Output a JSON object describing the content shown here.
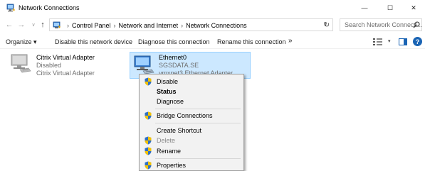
{
  "window": {
    "title": "Network Connections",
    "minimize_glyph": "—",
    "maximize_glyph": "☐",
    "close_glyph": "✕"
  },
  "nav": {
    "back_glyph": "←",
    "forward_glyph": "→",
    "recent_glyph": "∨",
    "up_glyph": "↑"
  },
  "address": {
    "separator": "›",
    "crumbs": [
      "Control Panel",
      "Network and Internet",
      "Network Connections"
    ],
    "dropdown_glyph": "∨",
    "refresh_glyph": "↻"
  },
  "search": {
    "placeholder": "Search Network Connecti..."
  },
  "toolbar": {
    "organize_label": "Organize ▾",
    "disable_label": "Disable this network device",
    "diagnose_label": "Diagnose this connection",
    "rename_label": "Rename this connection",
    "more_label": "»",
    "view_dropdown_glyph": "▾",
    "help_label": "?"
  },
  "adapters": [
    {
      "name": "Citrix Virtual Adapter",
      "status": "Disabled",
      "device": "Citrix Virtual Adapter",
      "icon": "network-adapter-icon"
    },
    {
      "name": "Ethernet0",
      "status": "SGSDATA.SE",
      "device": "vmxnet3 Ethernet Adapter",
      "icon": "network-adapter-icon"
    }
  ],
  "context_menu": {
    "items": [
      {
        "label": "Disable",
        "shield": true,
        "bold": false,
        "disabled": false
      },
      {
        "label": "Status",
        "shield": false,
        "bold": true,
        "disabled": false
      },
      {
        "label": "Diagnose",
        "shield": false,
        "bold": false,
        "disabled": false
      },
      {
        "label": "Bridge Connections",
        "shield": true,
        "bold": false,
        "disabled": false
      },
      {
        "label": "Create Shortcut",
        "shield": false,
        "bold": false,
        "disabled": false
      },
      {
        "label": "Delete",
        "shield": true,
        "bold": false,
        "disabled": true
      },
      {
        "label": "Rename",
        "shield": true,
        "bold": false,
        "disabled": false
      },
      {
        "label": "Properties",
        "shield": true,
        "bold": false,
        "disabled": false
      }
    ]
  },
  "colors": {
    "selection_fill": "#cce8ff",
    "selection_border": "#99d1ff",
    "accent": "#1a64b4"
  }
}
